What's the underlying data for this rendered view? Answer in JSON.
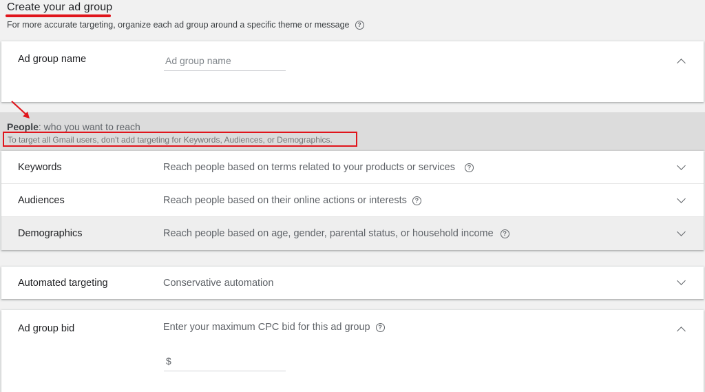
{
  "header": {
    "title": "Create your ad group",
    "subtitle": "For more accurate targeting, organize each ad group around a specific theme or message"
  },
  "ad_group_name": {
    "label": "Ad group name",
    "placeholder": "Ad group name",
    "value": ""
  },
  "people": {
    "title_bold": "People",
    "title_rest": ": who you want to reach",
    "note": "To target all Gmail users, don't add targeting for Keywords, Audiences, or Demographics."
  },
  "targeting_rows": [
    {
      "label": "Keywords",
      "description": "Reach people based on terms related to your products or services"
    },
    {
      "label": "Audiences",
      "description": "Reach people based on their online actions or interests"
    },
    {
      "label": "Demographics",
      "description": "Reach people based on age, gender, parental status, or household income"
    }
  ],
  "automated_targeting": {
    "label": "Automated targeting",
    "value": "Conservative automation"
  },
  "ad_group_bid": {
    "label": "Ad group bid",
    "description": "Enter your maximum CPC bid for this ad group",
    "currency_symbol": "$",
    "value": ""
  },
  "icons": {
    "help": "?",
    "help_icon_name": "help-circle-icon",
    "expand_icon_name": "chevron-down-icon",
    "collapse_icon_name": "chevron-up-icon"
  },
  "colors": {
    "annotation_red": "#e0151c",
    "band_gray": "#dcdcdc",
    "highlight_row": "#eeeeee"
  }
}
